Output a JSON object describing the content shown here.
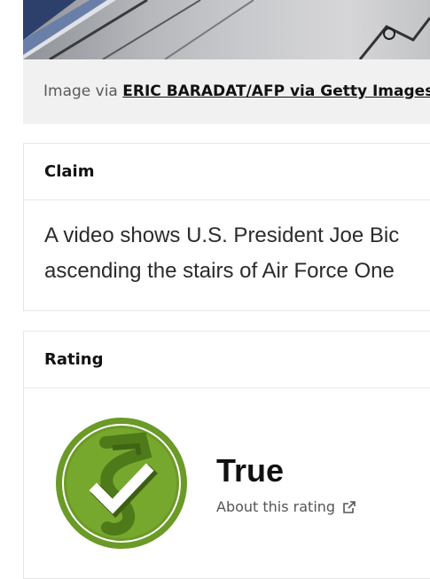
{
  "image": {
    "caption_prefix": "Image via",
    "credit_link": "ERIC BARADAT/AFP via Getty Images"
  },
  "claim": {
    "heading": "Claim",
    "line1": "A video shows U.S. President Joe Bic",
    "line2": "ascending the stairs of Air Force One"
  },
  "rating": {
    "heading": "Rating",
    "verdict": "True",
    "about_label": "About this rating",
    "badge_icon": "true-check-badge-icon",
    "badge_color": "#6b9a27"
  }
}
